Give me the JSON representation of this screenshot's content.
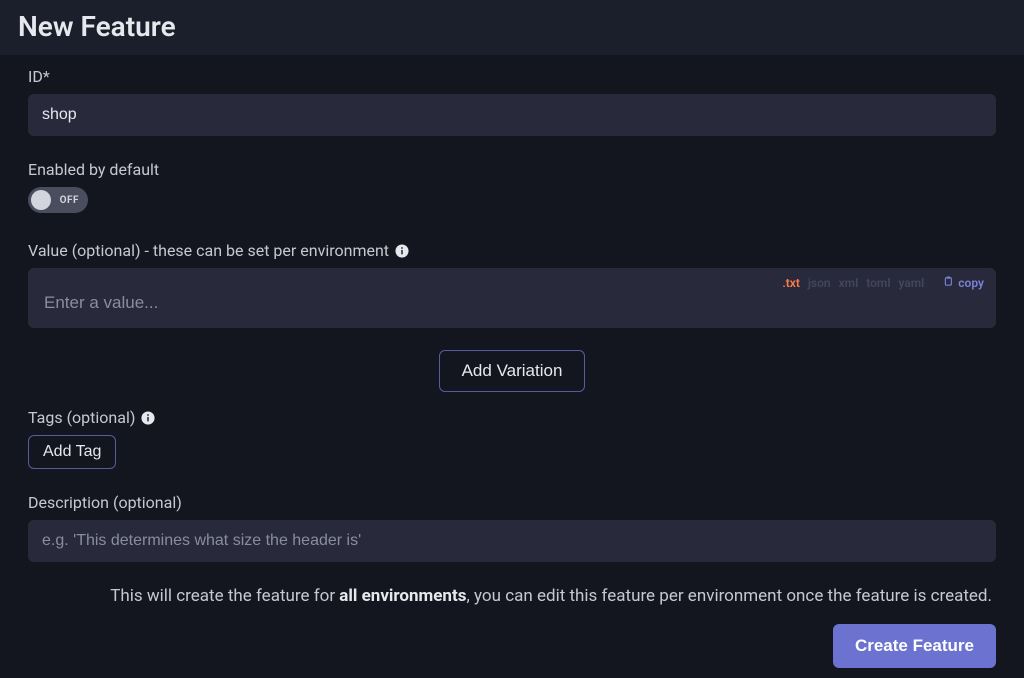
{
  "header": {
    "title": "New Feature"
  },
  "id_field": {
    "label": "ID*",
    "value": "shop"
  },
  "enabled_field": {
    "label": "Enabled by default",
    "toggle_state_label": "OFF",
    "toggle_on": false
  },
  "value_field": {
    "label": "Value (optional) - these can be set per environment",
    "placeholder": "Enter a value...",
    "value": "",
    "formats": [
      {
        "label": ".txt",
        "active": true
      },
      {
        "label": "json",
        "active": false
      },
      {
        "label": "xml",
        "active": false
      },
      {
        "label": "toml",
        "active": false
      },
      {
        "label": "yaml",
        "active": false
      }
    ],
    "copy_label": "copy"
  },
  "add_variation_label": "Add Variation",
  "tags_field": {
    "label": "Tags (optional)",
    "add_tag_label": "Add Tag"
  },
  "description_field": {
    "label": "Description (optional)",
    "placeholder": "e.g. 'This determines what size the header is'",
    "value": ""
  },
  "note": {
    "pre": "This will create the feature for ",
    "bold": "all environments",
    "post": ", you can edit this feature per environment once the feature is created."
  },
  "create_button_label": "Create Feature"
}
